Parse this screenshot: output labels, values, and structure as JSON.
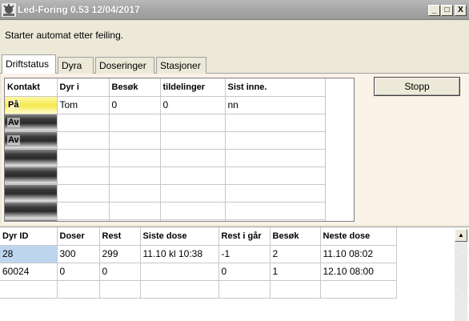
{
  "window": {
    "title": "Led-Foring 0.53 12/04/2017",
    "buttons": {
      "minimize": "_",
      "maximize": "□",
      "close": "X"
    }
  },
  "status": {
    "message": "Starter automat etter feiling."
  },
  "tabs": [
    {
      "label": "Driftstatus",
      "active": true
    },
    {
      "label": "Dyra",
      "active": false
    },
    {
      "label": "Doseringer",
      "active": false
    },
    {
      "label": "Stasjoner",
      "active": false
    }
  ],
  "stations_grid": {
    "headers": [
      "Kontakt",
      "Dyr i",
      "Besøk",
      "tildelinger",
      "Sist inne."
    ],
    "rows": [
      {
        "kontakt": "På",
        "kontakt_state": "on",
        "dyr_i": "Tom",
        "besok": "0",
        "tildelinger": "0",
        "sist_inne": "nn"
      },
      {
        "kontakt": "Av",
        "kontakt_state": "off",
        "dyr_i": "",
        "besok": "",
        "tildelinger": "",
        "sist_inne": ""
      },
      {
        "kontakt": "Av",
        "kontakt_state": "off",
        "dyr_i": "",
        "besok": "",
        "tildelinger": "",
        "sist_inne": ""
      },
      {
        "kontakt": "",
        "kontakt_state": "off",
        "dyr_i": "",
        "besok": "",
        "tildelinger": "",
        "sist_inne": ""
      },
      {
        "kontakt": "",
        "kontakt_state": "off",
        "dyr_i": "",
        "besok": "",
        "tildelinger": "",
        "sist_inne": ""
      },
      {
        "kontakt": "",
        "kontakt_state": "off",
        "dyr_i": "",
        "besok": "",
        "tildelinger": "",
        "sist_inne": ""
      },
      {
        "kontakt": "",
        "kontakt_state": "off",
        "dyr_i": "",
        "besok": "",
        "tildelinger": "",
        "sist_inne": ""
      },
      {
        "kontakt": "",
        "kontakt_state": "off",
        "dyr_i": "",
        "besok": "",
        "tildelinger": "",
        "sist_inne": ""
      }
    ]
  },
  "stop_button": {
    "label": "Stopp"
  },
  "dose_grid": {
    "headers": [
      "Dyr ID",
      "Doser",
      "Rest",
      "Siste dose",
      "Rest i går",
      "Besøk",
      "Neste dose"
    ],
    "rows": [
      {
        "dyr_id": "28",
        "doser": "300",
        "rest": "299",
        "siste_dose": "11.10 kl 10:38",
        "rest_i_gar": "-1",
        "besok": "2",
        "neste_dose": "11.10 08:02"
      },
      {
        "dyr_id": "60024",
        "doser": "0",
        "rest": "0",
        "siste_dose": "",
        "rest_i_gar": "0",
        "besok": "1",
        "neste_dose": "12.10 08:00"
      },
      {
        "dyr_id": "",
        "doser": "",
        "rest": "",
        "siste_dose": "",
        "rest_i_gar": "",
        "besok": "",
        "neste_dose": ""
      }
    ]
  },
  "colors": {
    "panel_bg": "#fbf2e8",
    "kontakt_on": "#f5e84a",
    "kontakt_off": "#2a2a2a",
    "selected_cell": "#bdd6ee"
  }
}
